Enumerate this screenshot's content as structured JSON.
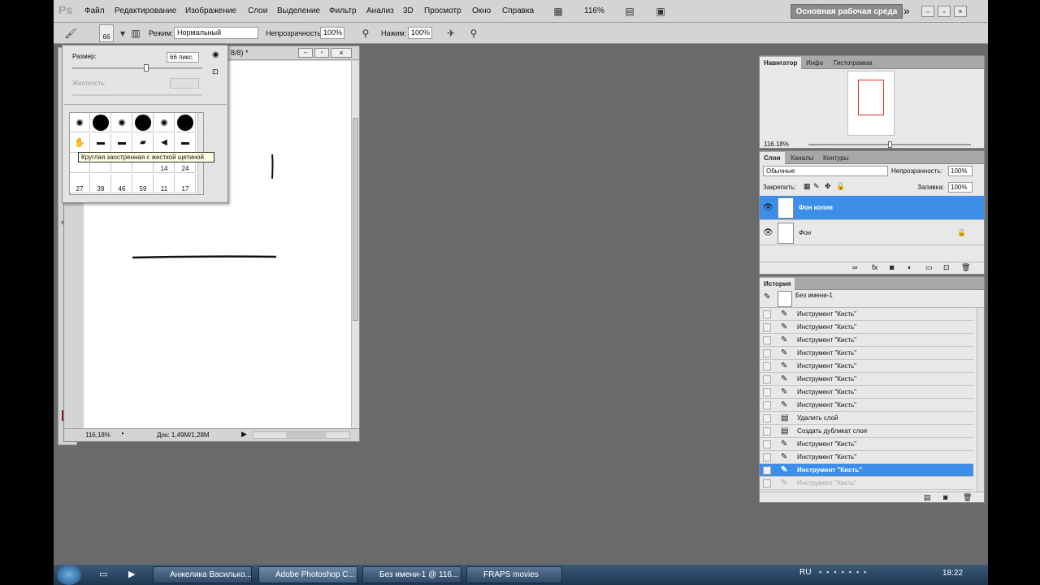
{
  "menubar": {
    "logo": "Ps",
    "items": [
      "Файл",
      "Редактирование",
      "Изображение",
      "Слои",
      "Выделение",
      "Фильтр",
      "Анализ",
      "3D",
      "Просмотр",
      "Окно",
      "Справка"
    ],
    "zoom": "116%",
    "workspace": "Основная рабочая среда"
  },
  "options": {
    "brush_size": "66",
    "mode_label": "Режим:",
    "mode_value": "Нормальный",
    "opacity_label": "Непрозрачность:",
    "opacity_value": "100%",
    "flow_label": "Нажим:",
    "flow_value": "100%"
  },
  "document": {
    "title_suffix": "8/8) *",
    "zoom": "116,18%",
    "doc_info": "Док: 1,49M/1,28M"
  },
  "brush_picker": {
    "size_label": "Размер:",
    "size_value": "66 пикс.",
    "hardness_label": "Жесткость:",
    "tooltip": "Круглая заостренная с жесткой щетиной",
    "row3_numbers": [
      "14",
      "24"
    ],
    "row4_numbers": [
      "27",
      "39",
      "46",
      "59",
      "11",
      "17"
    ]
  },
  "navigator": {
    "tabs": [
      "Навигатор",
      "Инфо",
      "Гистограмма"
    ],
    "zoom": "116.18%"
  },
  "layers": {
    "tabs": [
      "Слои",
      "Каналы",
      "Контуры"
    ],
    "blend_mode": "Обычные",
    "opacity_label": "Непрозрачность:",
    "opacity_value": "100%",
    "lock_label": "Закрепить:",
    "fill_label": "Заливка:",
    "fill_value": "100%",
    "items": [
      {
        "name": "Фон копия",
        "selected": true
      },
      {
        "name": "Фон",
        "selected": false
      }
    ],
    "selected_color": "#3d8ee8"
  },
  "history": {
    "tab": "История",
    "snapshot": "Без имени-1",
    "items": [
      {
        "label": "Инструмент \"Кисть\"",
        "icon": "brush-icon",
        "state": "normal"
      },
      {
        "label": "Инструмент \"Кисть\"",
        "icon": "brush-icon",
        "state": "normal"
      },
      {
        "label": "Инструмент \"Кисть\"",
        "icon": "brush-icon",
        "state": "normal"
      },
      {
        "label": "Инструмент \"Кисть\"",
        "icon": "brush-icon",
        "state": "normal"
      },
      {
        "label": "Инструмент \"Кисть\"",
        "icon": "brush-icon",
        "state": "normal"
      },
      {
        "label": "Инструмент \"Кисть\"",
        "icon": "brush-icon",
        "state": "normal"
      },
      {
        "label": "Инструмент \"Кисть\"",
        "icon": "brush-icon",
        "state": "normal"
      },
      {
        "label": "Инструмент \"Кисть\"",
        "icon": "brush-icon",
        "state": "normal"
      },
      {
        "label": "Удалить слой",
        "icon": "document-icon",
        "state": "normal"
      },
      {
        "label": "Создать дубликат слоя",
        "icon": "document-icon",
        "state": "normal"
      },
      {
        "label": "Инструмент \"Кисть\"",
        "icon": "brush-icon",
        "state": "normal"
      },
      {
        "label": "Инструмент \"Кисть\"",
        "icon": "brush-icon",
        "state": "normal"
      },
      {
        "label": "Инструмент \"Кисть\"",
        "icon": "brush-icon",
        "state": "selected"
      },
      {
        "label": "Инструмент \"Кисть\"",
        "icon": "brush-icon",
        "state": "dimmed"
      }
    ]
  },
  "colors": {
    "foreground": "#e01010",
    "background": "#000000"
  },
  "taskbar": {
    "items": [
      {
        "label": "Анжелика Василько...",
        "active": false
      },
      {
        "label": "Adobe Photoshop C...",
        "active": true
      },
      {
        "label": "Без имени-1 @ 116...",
        "active": false
      },
      {
        "label": "FRAPS movies",
        "active": false
      }
    ],
    "lang": "RU",
    "clock": "18:22"
  }
}
